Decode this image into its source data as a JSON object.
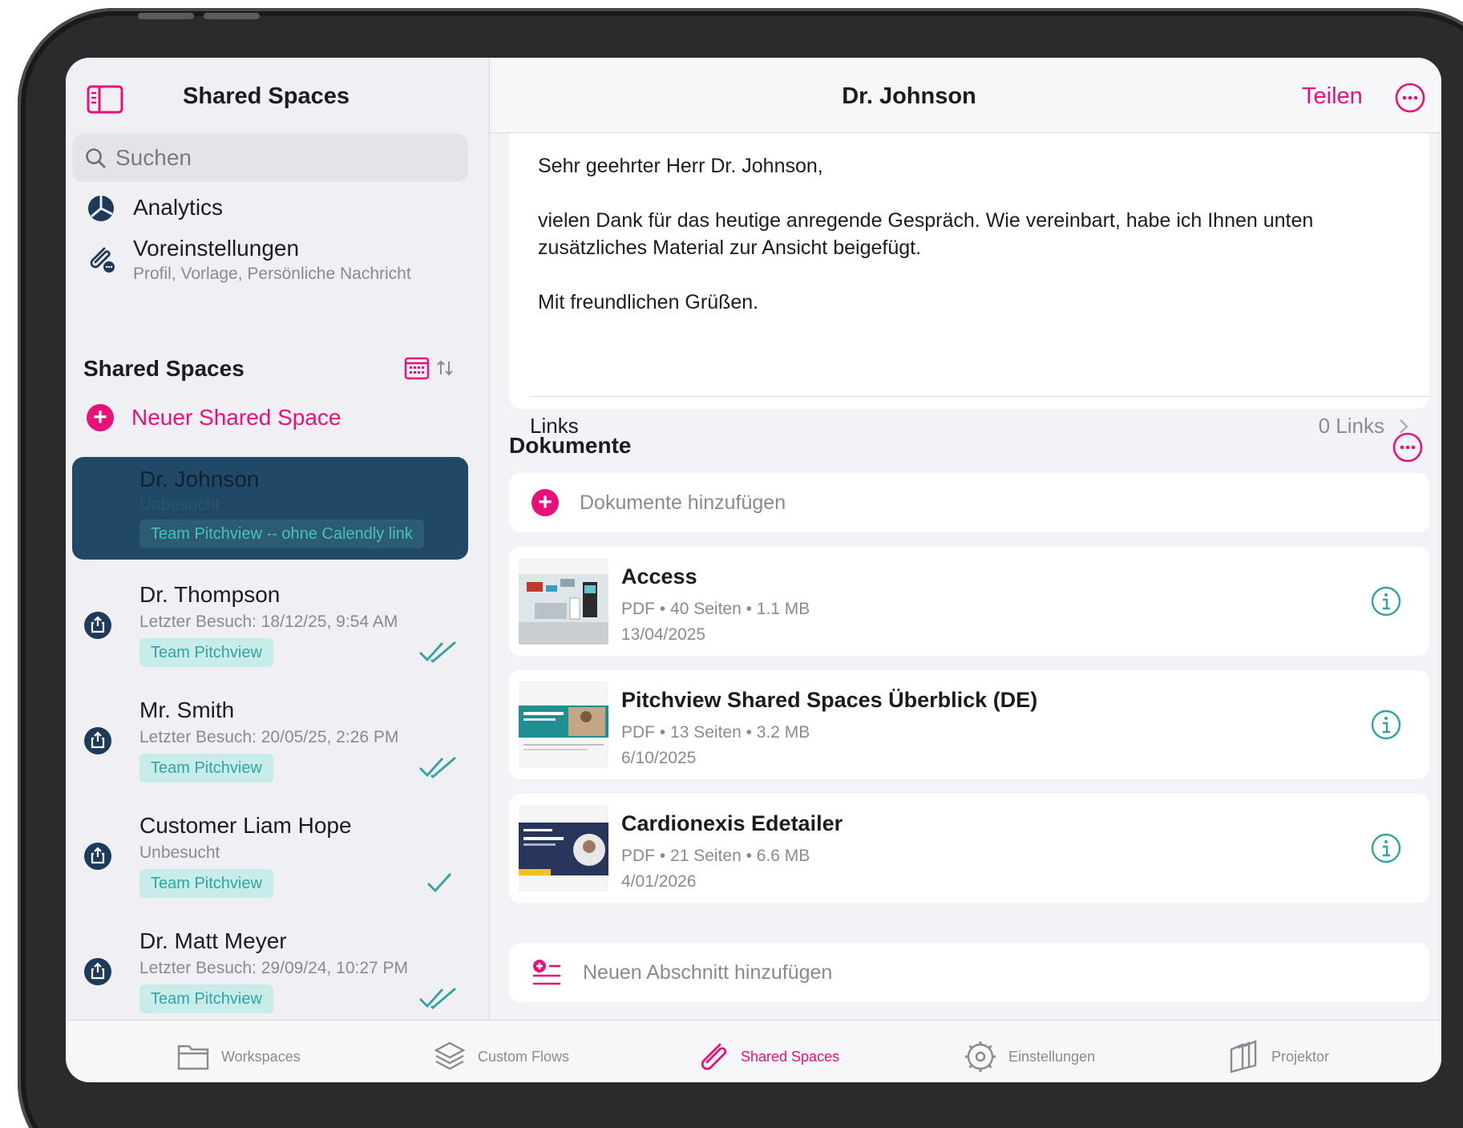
{
  "sidebar": {
    "title": "Shared Spaces",
    "search_placeholder": "Suchen",
    "nav": {
      "analytics": "Analytics",
      "presets": "Voreinstellungen",
      "presets_sub": "Profil, Vorlage, Persönliche Nachricht"
    },
    "section_title": "Shared Spaces",
    "new_space": "Neuer Shared Space",
    "spaces": [
      {
        "name": "Dr. Johnson",
        "meta": "Unbesucht",
        "tag": "Team Pitchview -- ohne Calendly link"
      },
      {
        "name": "Dr. Thompson",
        "meta": "Letzter Besuch: 18/12/25, 9:54 AM",
        "tag": "Team Pitchview"
      },
      {
        "name": "Mr. Smith",
        "meta": "Letzter Besuch: 20/05/25, 2:26 PM",
        "tag": "Team Pitchview"
      },
      {
        "name": "Customer Liam Hope",
        "meta": "Unbesucht",
        "tag": "Team Pitchview"
      },
      {
        "name": "Dr. Matt Meyer",
        "meta": "Letzter Besuch: 29/09/24, 10:27 PM",
        "tag": "Team Pitchview"
      }
    ]
  },
  "main": {
    "title": "Dr. Johnson",
    "share_label": "Teilen",
    "message": {
      "greeting": "Sehr geehrter Herr Dr. Johnson,",
      "body": "vielen Dank für das heutige anregende Gespräch. Wie vereinbart, habe ich Ihnen unten zusätzliches Material zur Ansicht beigefügt.",
      "closing": "Mit freundlichen Grüßen."
    },
    "links_label": "Links",
    "links_count": "0 Links",
    "documents_title": "Dokumente",
    "add_documents": "Dokumente hinzufügen",
    "documents": [
      {
        "name": "Access",
        "meta": "PDF • 40 Seiten • 1.1 MB",
        "date": "13/04/2025"
      },
      {
        "name": "Pitchview Shared Spaces Überblick (DE)",
        "meta": "PDF • 13 Seiten • 3.2 MB",
        "date": "6/10/2025"
      },
      {
        "name": "Cardionexis Edetailer",
        "meta": "PDF • 21 Seiten • 6.6 MB",
        "date": "4/01/2026"
      }
    ],
    "add_section": "Neuen Abschnitt hinzufügen"
  },
  "tabs": [
    {
      "label": "Workspaces",
      "icon": "folder-icon"
    },
    {
      "label": "Custom Flows",
      "icon": "layers-icon"
    },
    {
      "label": "Shared Spaces",
      "icon": "paperclip-icon"
    },
    {
      "label": "Einstellungen",
      "icon": "gear-icon"
    },
    {
      "label": "Projektor",
      "icon": "projector-icon"
    }
  ],
  "colors": {
    "accent": "#e6127a",
    "selected": "#214866",
    "teal": "#2fa5a3",
    "navy": "#1d3a5a"
  }
}
